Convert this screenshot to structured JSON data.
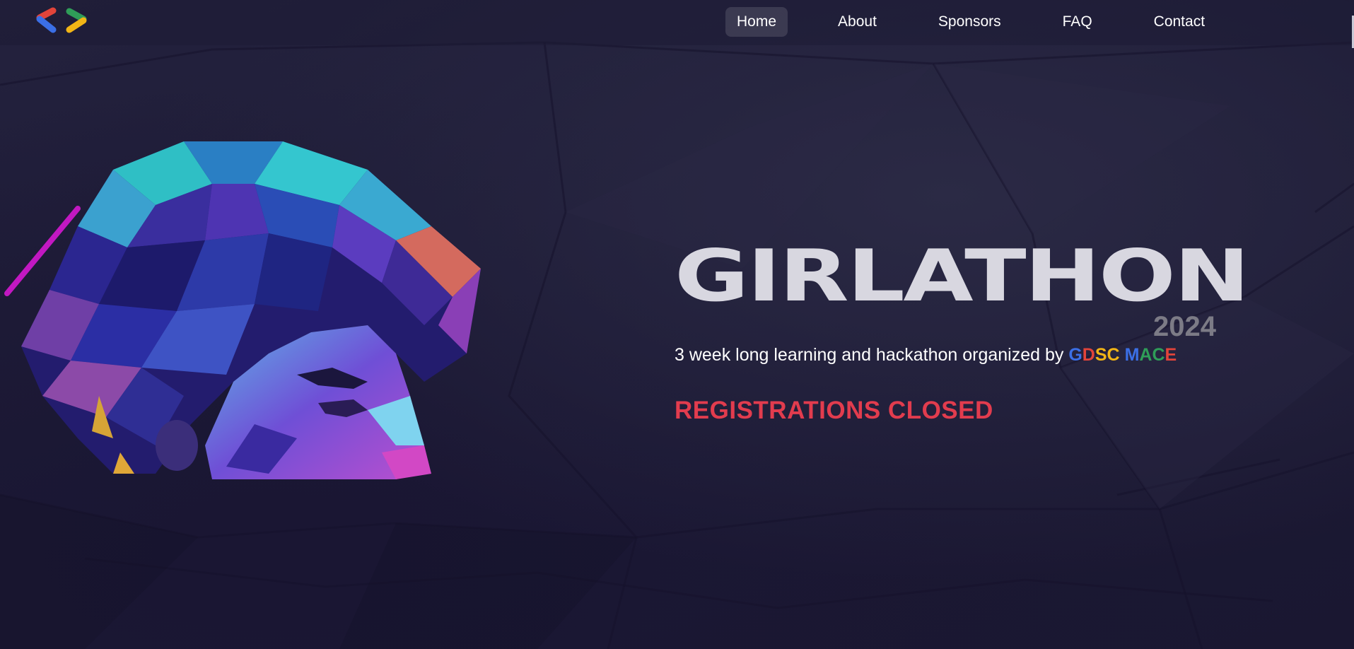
{
  "nav": {
    "logo_icon": "gdsc-brackets-logo",
    "items": [
      {
        "label": "Home",
        "active": true
      },
      {
        "label": "About",
        "active": false
      },
      {
        "label": "Sponsors",
        "active": false
      },
      {
        "label": "FAQ",
        "active": false
      },
      {
        "label": "Contact",
        "active": false
      }
    ]
  },
  "hero": {
    "image_icon": "polygonal-woman-portrait",
    "title": "GIRLATHON",
    "year": "2024",
    "tagline_prefix": "3 week long learning and hackathon organized by",
    "brand": {
      "G": "G",
      "D": "D",
      "S": "S",
      "C": "C",
      "M": "M",
      "A": "A",
      "C2": "C",
      "E": "E"
    },
    "status": "REGISTRATIONS CLOSED"
  },
  "colors": {
    "background": "#1b1834",
    "title": "#d8d7e0",
    "year": "#7c7b86",
    "status": "#e23c4e",
    "google_blue": "#3b6fe6",
    "google_red": "#e2443a",
    "google_yellow": "#f2b516",
    "google_green": "#2f9d58"
  }
}
